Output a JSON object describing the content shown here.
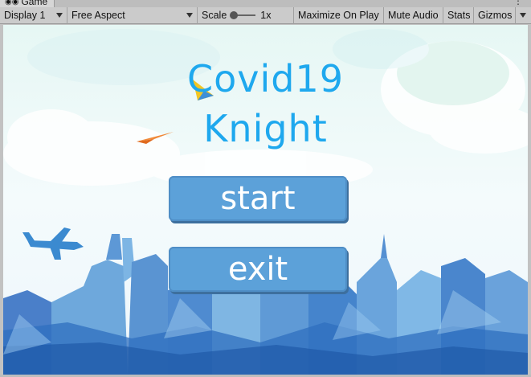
{
  "tab": {
    "label": "Game",
    "icon": "gamepad-icon"
  },
  "toolbar": {
    "display": "Display 1",
    "aspect": "Free Aspect",
    "scale_label": "Scale",
    "scale_value": "1x",
    "scale_level": 0,
    "maximize": "Maximize On Play",
    "mute": "Mute Audio",
    "stats": "Stats",
    "gizmos": "Gizmos"
  },
  "game": {
    "title_line1": "Covid19",
    "title_line2": "Knight",
    "start_label": "start",
    "exit_label": "exit"
  },
  "colors": {
    "title": "#1ea8ee",
    "button": "#5ca1d9",
    "city": "#3f86cc"
  }
}
